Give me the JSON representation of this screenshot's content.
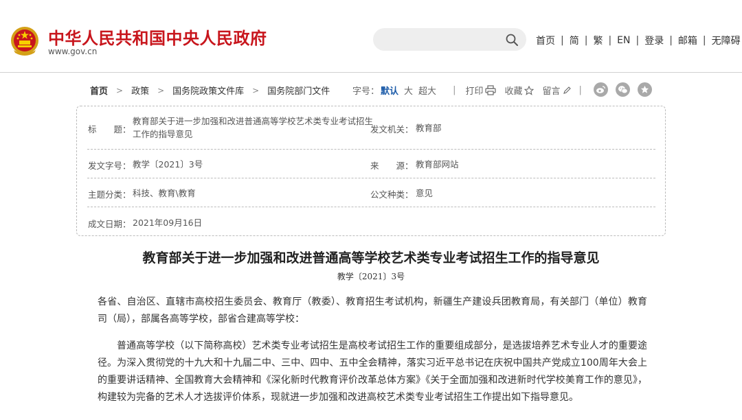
{
  "header": {
    "site_title": "中华人民共和国中央人民政府",
    "site_url": "www.gov.cn",
    "search_placeholder": "",
    "nav": [
      "首页",
      "简",
      "繁",
      "EN",
      "登录",
      "邮箱",
      "无障碍"
    ]
  },
  "breadcrumb": [
    "首页",
    "政策",
    "国务院政策文件库",
    "国务院部门文件"
  ],
  "toolbar": {
    "font_size_label": "字号：",
    "font_sizes": [
      "默认",
      "大",
      "超大"
    ],
    "print": "打印",
    "favorite": "收藏",
    "comment": "留言",
    "share_icons": [
      "weibo-icon",
      "wechat-icon",
      "star-share-icon"
    ]
  },
  "meta": {
    "title_label": "标　　题：",
    "title_value": "教育部关于进一步加强和改进普通高等学校艺术类专业考试招生工作的指导意见",
    "issuer_label": "发文机关：",
    "issuer_value": "教育部",
    "doc_number_label": "发文字号：",
    "doc_number_value": "教学〔2021〕3号",
    "source_label": "来　　源：",
    "source_value": "教育部网站",
    "category_label": "主题分类：",
    "category_value": "科技、教育\\教育",
    "doc_type_label": "公文种类：",
    "doc_type_value": "意见",
    "date_label": "成文日期：",
    "date_value": "2021年09月16日"
  },
  "document": {
    "title": "教育部关于进一步加强和改进普通高等学校艺术类专业考试招生工作的指导意见",
    "number": "教学〔2021〕3号",
    "addressees": "各省、自治区、直辖市高校招生委员会、教育厅（教委）、教育招生考试机构，新疆生产建设兵团教育局，有关部门（单位）教育司（局），部属各高等学校，部省合建高等学校：",
    "paragraph1": "普通高等学校（以下简称高校）艺术类专业考试招生是高校考试招生工作的重要组成部分，是选拔培养艺术专业人才的重要途径。为深入贯彻党的十九大和十九届二中、三中、四中、五中全会精神，落实习近平总书记在庆祝中国共产党成立100周年大会上的重要讲话精神、全国教育大会精神和《深化新时代教育评价改革总体方案》《关于全面加强和改进新时代学校美育工作的意见》，构建较为完备的艺术人才选拔评价体系，现就进一步加强和改进高校艺术类专业考试招生工作提出如下指导意见。"
  },
  "colors": {
    "brand_red": "#c8161d",
    "link_blue": "#1a5aa8",
    "share_grey": "#a9a9a9"
  }
}
